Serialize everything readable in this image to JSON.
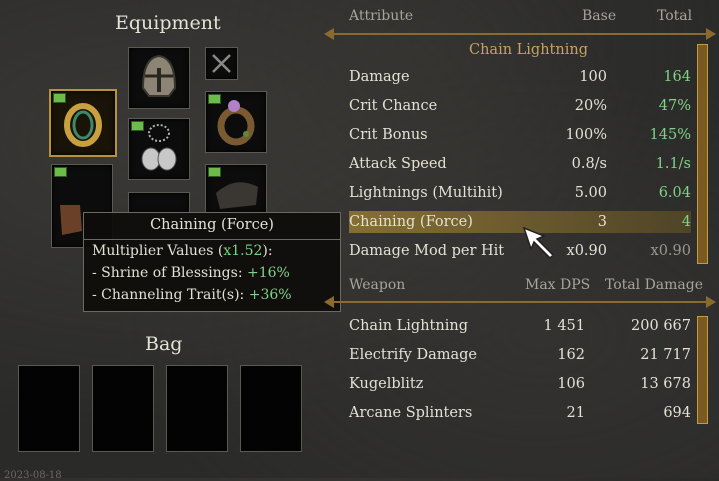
{
  "equipment": {
    "title": "Equipment"
  },
  "bag": {
    "title": "Bag"
  },
  "attributes": {
    "header": {
      "attribute": "Attribute",
      "base": "Base",
      "total": "Total"
    },
    "skill_title": "Chain Lightning",
    "rows": [
      {
        "label": "Damage",
        "base": "100",
        "total": "164"
      },
      {
        "label": "Crit Chance",
        "base": "20%",
        "total": "47%"
      },
      {
        "label": "Crit Bonus",
        "base": "100%",
        "total": "145%"
      },
      {
        "label": "Attack Speed",
        "base": "0.8/s",
        "total": "1.1/s"
      },
      {
        "label": "Lightnings (Multihit)",
        "base": "5.00",
        "total": "6.04"
      },
      {
        "label": "Chaining (Force)",
        "base": "3",
        "total": "4"
      },
      {
        "label": "Damage Mod per Hit",
        "base": "x0.90",
        "total": "x0.90"
      }
    ]
  },
  "weapons": {
    "header": {
      "weapon": "Weapon",
      "max_dps": "Max DPS",
      "total_damage": "Total Damage"
    },
    "rows": [
      {
        "label": "Chain Lightning",
        "dps": "1 451",
        "damage": "200 667"
      },
      {
        "label": "Electrify Damage",
        "dps": "162",
        "damage": "21 717"
      },
      {
        "label": "Kugelblitz",
        "dps": "106",
        "damage": "13 678"
      },
      {
        "label": "Arcane Splinters",
        "dps": "21",
        "damage": "694"
      }
    ]
  },
  "tooltip": {
    "title": "Chaining (Force)",
    "multiplier_label": "Multiplier Values (",
    "multiplier_value": "x1.52",
    "multiplier_suffix": "):",
    "line1_label": "- Shrine of Blessings: ",
    "line1_value": "+16%",
    "line2_label": "- Channeling Trait(s): ",
    "line2_value": "+36%"
  },
  "footer": {
    "date": "2023-08-18"
  },
  "colors": {
    "positive": "#7fd386",
    "accent_gold": "#b8923a",
    "highlight": "#a0823"
  }
}
